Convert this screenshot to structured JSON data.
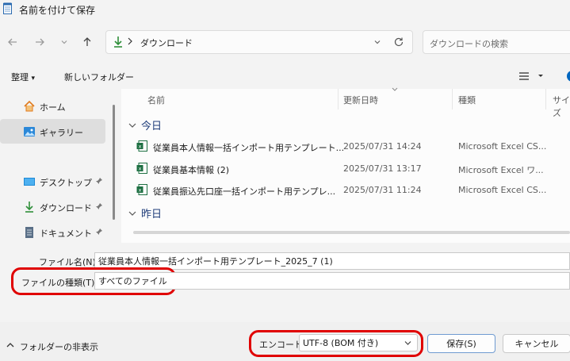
{
  "window": {
    "title": "名前を付けて保存"
  },
  "address": {
    "path": "ダウンロード",
    "search_placeholder": "ダウンロードの検索"
  },
  "toolbar": {
    "organize_label": "整理",
    "new_folder_label": "新しいフォルダー"
  },
  "sidebar": {
    "items": [
      {
        "label": "ホーム",
        "icon": "home-icon"
      },
      {
        "label": "ギャラリー",
        "icon": "gallery-icon",
        "selected": true
      },
      {
        "label": "デスクトップ",
        "icon": "desktop-icon",
        "pinned": true
      },
      {
        "label": "ダウンロード",
        "icon": "download-icon",
        "pinned": true
      },
      {
        "label": "ドキュメント",
        "icon": "document-icon",
        "pinned": true
      }
    ]
  },
  "columns": {
    "name": "名前",
    "modified": "更新日時",
    "type": "種類",
    "size": "サイズ"
  },
  "groups": {
    "today": "今日",
    "yesterday": "昨日"
  },
  "files": [
    {
      "name": "従業員本人情報一括インポート用テンプレート...",
      "modified": "2025/07/31 14:24",
      "type": "Microsoft Excel CS..."
    },
    {
      "name": "従業員基本情報 (2)",
      "modified": "2025/07/31 13:17",
      "type": "Microsoft Excel ワ..."
    },
    {
      "name": "従業員振込先口座一括インポート用テンプレ...",
      "modified": "2025/07/31 11:24",
      "type": "Microsoft Excel CS..."
    }
  ],
  "form": {
    "filename_label": "ファイル名(N):",
    "filename_value": "従業員本人情報一括インポート用テンプレート_2025_7 (1)",
    "filetype_label": "ファイルの種類(T):",
    "filetype_value": "すべてのファイル"
  },
  "footer": {
    "hide_folders_label": "フォルダーの非表示",
    "encoding_label": "エンコード:",
    "encoding_value": "UTF-8 (BOM 付き)",
    "save_label": "保存(S)",
    "cancel_label": "キャンセル"
  },
  "colors": {
    "annotation": "#e00000",
    "accent": "#0067c0",
    "excel": "#1d6f42"
  }
}
